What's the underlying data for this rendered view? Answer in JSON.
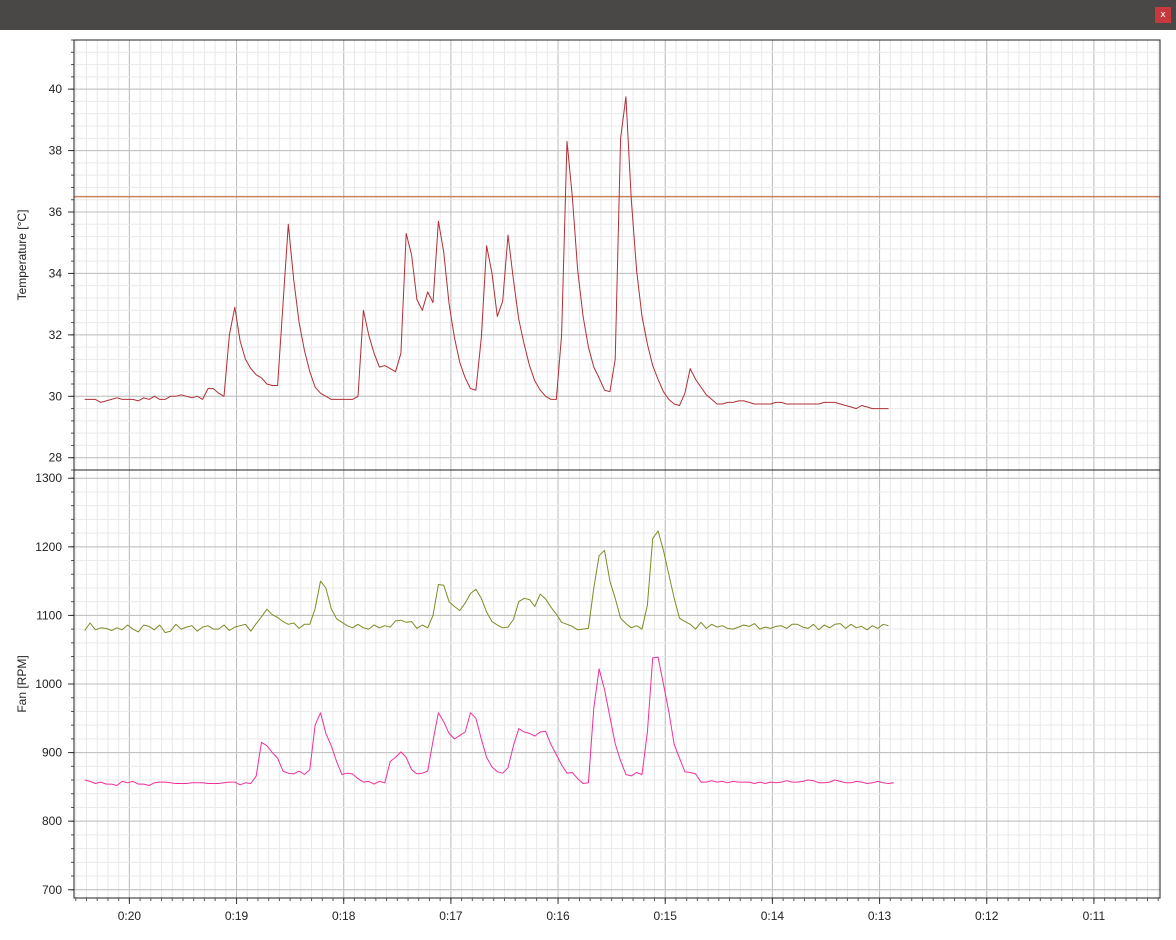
{
  "window": {
    "close_icon": "x",
    "title": ""
  },
  "colors": {
    "temperature": "#b03036",
    "threshold": "#c8825c",
    "fan1": "#808a26",
    "fan2": "#f0309b",
    "grid_major": "#bdbdbd",
    "grid_minor": "#e9e9e9"
  },
  "chart_data": [
    {
      "type": "line",
      "ylabel": "Temperature [°C]",
      "ylim": [
        27.6,
        41.6
      ],
      "yticks": [
        "28",
        "30",
        "32",
        "34",
        "36",
        "38",
        "40"
      ],
      "threshold": 36.5,
      "x": [
        1225,
        1222,
        1219,
        1216,
        1213,
        1210,
        1207,
        1204,
        1201,
        1198,
        1195,
        1192,
        1189,
        1186,
        1183,
        1180,
        1177,
        1174,
        1171,
        1168,
        1165,
        1162,
        1159,
        1156,
        1153,
        1150,
        1147,
        1144,
        1141,
        1138,
        1135,
        1132,
        1129,
        1126,
        1123,
        1120,
        1117,
        1114,
        1111,
        1108,
        1105,
        1102,
        1099,
        1096,
        1093,
        1090,
        1087,
        1084,
        1081,
        1078,
        1075,
        1072,
        1069,
        1066,
        1063,
        1060,
        1057,
        1054,
        1051,
        1048,
        1045,
        1042,
        1039,
        1036,
        1033,
        1030,
        1027,
        1024,
        1021,
        1018,
        1015,
        1012,
        1009,
        1006,
        1003,
        1000,
        997,
        994,
        991,
        988,
        985,
        982,
        979,
        976,
        973,
        970,
        967,
        964,
        961,
        958,
        955,
        952,
        949,
        946,
        943,
        940,
        937,
        934,
        931,
        928,
        925,
        922,
        919,
        916,
        913,
        910,
        907,
        904,
        901,
        898,
        895,
        892,
        889,
        886,
        883,
        880,
        877,
        874,
        871,
        868,
        865,
        862,
        859,
        856,
        853,
        850,
        847,
        844,
        841,
        838,
        835,
        832,
        829,
        826,
        823,
        820,
        817,
        814,
        811,
        808,
        805,
        802,
        799,
        796,
        793,
        790,
        787,
        784,
        781,
        778,
        775,
        772,
        769,
        766,
        763,
        760,
        757,
        754,
        751,
        748,
        745,
        742,
        739,
        736,
        733,
        730,
        727,
        724,
        721,
        718,
        715,
        712,
        709,
        706,
        703,
        700,
        697,
        694,
        691,
        688,
        685,
        682,
        679,
        676,
        673,
        670,
        667,
        664,
        661,
        658
      ],
      "series": [
        {
          "values": [
            29.9,
            29.9,
            29.9,
            29.8,
            29.85,
            29.9,
            29.95,
            29.9,
            29.9,
            29.9,
            29.85,
            29.95,
            29.9,
            30.0,
            29.9,
            29.9,
            30.0,
            30.0,
            30.05,
            30.0,
            29.95,
            30.0,
            29.9,
            30.25,
            30.25,
            30.1,
            30.0,
            32.0,
            32.9,
            31.8,
            31.2,
            30.9,
            30.7,
            30.6,
            30.4,
            30.35,
            30.35,
            33.0,
            35.6,
            33.8,
            32.4,
            31.5,
            30.8,
            30.3,
            30.1,
            30.0,
            29.9,
            29.9,
            29.9,
            29.9,
            29.9,
            30.0,
            32.8,
            32.0,
            31.4,
            30.95,
            31.0,
            30.9,
            30.8,
            31.4,
            35.3,
            34.6,
            33.15,
            32.8,
            33.4,
            33.05,
            35.7,
            34.7,
            33.0,
            31.9,
            31.1,
            30.6,
            30.25,
            30.2,
            31.9,
            34.9,
            34.0,
            32.6,
            33.1,
            35.25,
            33.8,
            32.5,
            31.7,
            31.0,
            30.5,
            30.2,
            30.0,
            29.9,
            29.9,
            32.0,
            38.3,
            36.5,
            34.1,
            32.6,
            31.6,
            30.95,
            30.6,
            30.2,
            30.15,
            31.2,
            38.4,
            39.75,
            36.4,
            34.1,
            32.6,
            31.7,
            31.0,
            30.55,
            30.15,
            29.9,
            29.75,
            29.7,
            30.1,
            30.9,
            30.55,
            30.3,
            30.05,
            29.9,
            29.75,
            29.75,
            29.8,
            29.8,
            29.85,
            29.85,
            29.8,
            29.75,
            29.75,
            29.75,
            29.75,
            29.8,
            29.8,
            29.75,
            29.75,
            29.75,
            29.75,
            29.75,
            29.75,
            29.75,
            29.8,
            29.8,
            29.8,
            29.75,
            29.7,
            29.65,
            29.6,
            29.7,
            29.65,
            29.6,
            29.6,
            29.6,
            29.6
          ]
        },
        {
          "name": "",
          "values": [
            36.5
          ]
        }
      ]
    },
    {
      "type": "line",
      "ylabel": "Fan [RPM]",
      "ylim": [
        688,
        1312
      ],
      "yticks": [
        "700",
        "800",
        "900",
        "1000",
        "1100",
        "1200",
        "1300"
      ],
      "series": [
        {
          "values": [
            1078,
            1089,
            1079,
            1082,
            1081,
            1078,
            1082,
            1079,
            1086,
            1080,
            1076,
            1086,
            1084,
            1079,
            1086,
            1075,
            1077,
            1087,
            1080,
            1083,
            1085,
            1077,
            1083,
            1085,
            1080,
            1080,
            1086,
            1078,
            1083,
            1085,
            1087,
            1077,
            1088,
            1098,
            1109,
            1101,
            1097,
            1091,
            1087,
            1089,
            1081,
            1087,
            1087,
            1110,
            1150,
            1140,
            1110,
            1095,
            1090,
            1085,
            1082,
            1087,
            1082,
            1080,
            1086,
            1082,
            1085,
            1083,
            1092,
            1093,
            1090,
            1091,
            1081,
            1086,
            1082,
            1100,
            1145,
            1144,
            1120,
            1113,
            1107,
            1118,
            1132,
            1138,
            1125,
            1105,
            1091,
            1086,
            1082,
            1083,
            1094,
            1120,
            1125,
            1123,
            1113,
            1131,
            1124,
            1112,
            1102,
            1090,
            1087,
            1084,
            1079,
            1080,
            1081,
            1140,
            1187,
            1195,
            1150,
            1125,
            1096,
            1088,
            1082,
            1085,
            1080,
            1115,
            1212,
            1223,
            1195,
            1160,
            1125,
            1096,
            1091,
            1087,
            1080,
            1090,
            1081,
            1087,
            1083,
            1085,
            1081,
            1080,
            1083,
            1086,
            1084,
            1088,
            1080,
            1083,
            1081,
            1084,
            1085,
            1081,
            1087,
            1087,
            1083,
            1081,
            1087,
            1079,
            1086,
            1082,
            1087,
            1088,
            1081,
            1087,
            1082,
            1084,
            1079,
            1085,
            1081,
            1087,
            1085
          ]
        },
        {
          "values": [
            860,
            858,
            855,
            857,
            854,
            854,
            852,
            858,
            856,
            858,
            854,
            854,
            852,
            856,
            857,
            857,
            856,
            855,
            855,
            855,
            856,
            856,
            856,
            855,
            855,
            855,
            856,
            857,
            857,
            853,
            856,
            855,
            866,
            915,
            910,
            900,
            892,
            873,
            870,
            869,
            873,
            868,
            875,
            940,
            958,
            928,
            910,
            887,
            868,
            870,
            869,
            862,
            857,
            858,
            854,
            858,
            856,
            887,
            893,
            901,
            893,
            875,
            869,
            870,
            873,
            917,
            958,
            945,
            928,
            920,
            925,
            930,
            958,
            950,
            920,
            893,
            879,
            872,
            870,
            878,
            910,
            935,
            930,
            928,
            924,
            930,
            931,
            912,
            897,
            882,
            870,
            871,
            862,
            855,
            856,
            965,
            1022,
            992,
            952,
            913,
            888,
            868,
            866,
            871,
            868,
            930,
            1038,
            1039,
            1000,
            960,
            912,
            892,
            872,
            871,
            869,
            857,
            857,
            859,
            857,
            858,
            856,
            858,
            857,
            857,
            857,
            855,
            857,
            855,
            857,
            856,
            857,
            859,
            857,
            857,
            858,
            860,
            859,
            856,
            856,
            857,
            860,
            858,
            856,
            856,
            858,
            857,
            855,
            856,
            858,
            856,
            855,
            856
          ]
        }
      ]
    }
  ],
  "x_axis": {
    "tick_labels": [
      "0:20",
      "0:19",
      "0:18",
      "0:17",
      "0:16",
      "0:15",
      "0:14",
      "0:13",
      "0:12",
      "0:11"
    ],
    "tick_seconds": [
      1200,
      1140,
      1080,
      1020,
      960,
      900,
      840,
      780,
      720,
      660
    ],
    "xlim": [
      1231,
      623
    ],
    "grid": true
  }
}
